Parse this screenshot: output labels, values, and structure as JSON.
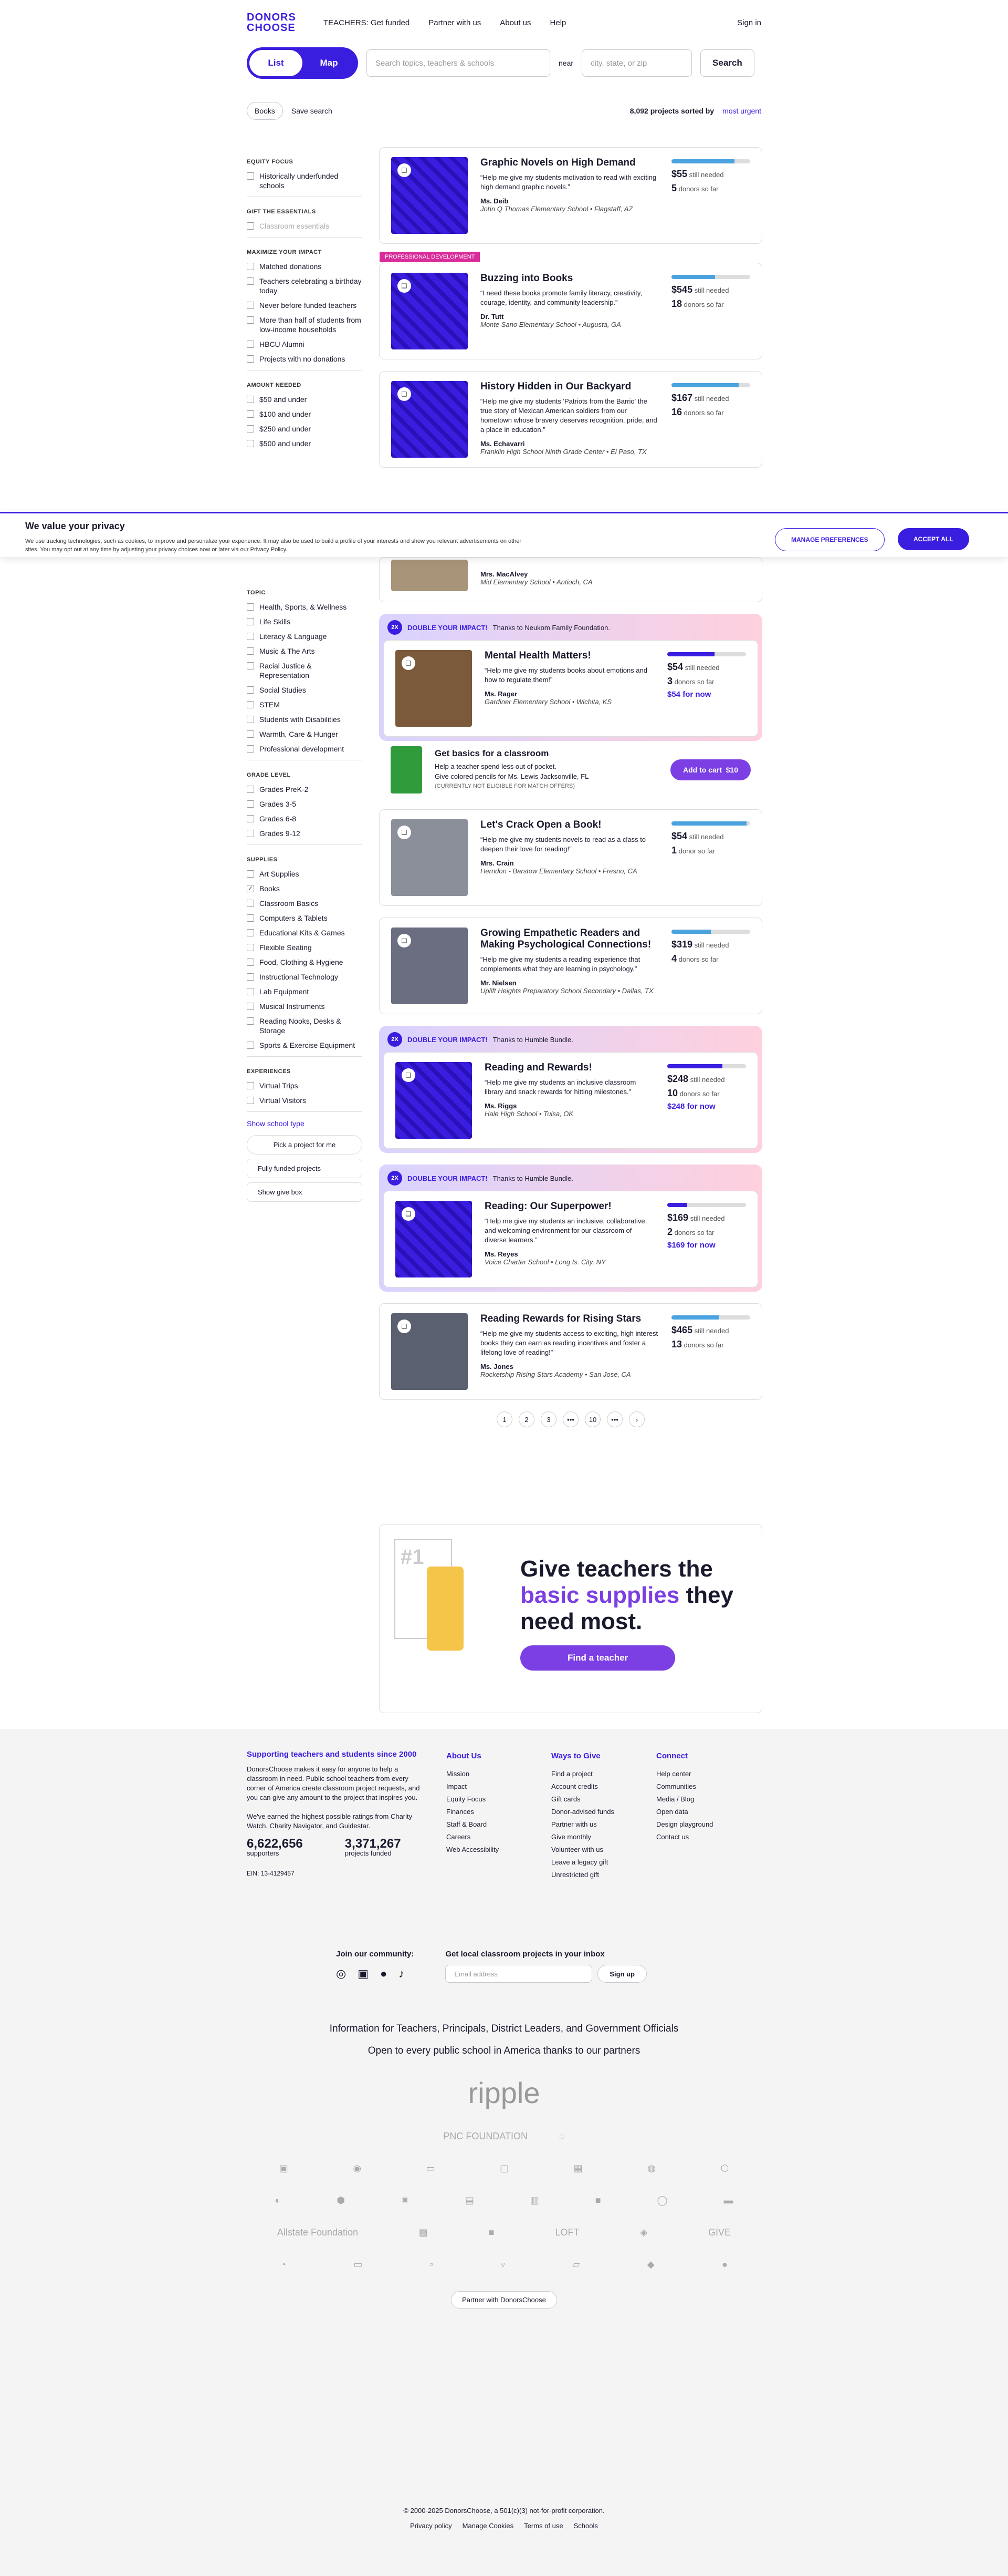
{
  "nav": {
    "logo": "DONORS CHOOSE",
    "teachers": "TEACHERS: Get funded",
    "partner": "Partner with us",
    "about": "About us",
    "help": "Help",
    "signin": "Sign in"
  },
  "search": {
    "list": "List",
    "map": "Map",
    "placeholder": "Search topics, teachers & schools",
    "near": "near",
    "city_placeholder": "city, state, or zip",
    "button": "Search"
  },
  "filters": {
    "books": "Books",
    "save": "Save search",
    "count": "8,092 projects sorted by",
    "sort": "most urgent"
  },
  "sidebar": {
    "equity": "EQUITY FOCUS",
    "hist": "Historically underfunded schools",
    "gift": "GIFT THE ESSENTIALS",
    "classroom": "Classroom essentials",
    "maximize": "MAXIMIZE YOUR IMPACT",
    "matched": "Matched donations",
    "birthday": "Teachers celebrating a birthday today",
    "never": "Never before funded teachers",
    "half": "More than half of students from low-income households",
    "hbcu": "HBCU Alumni",
    "nodon": "Projects with no donations",
    "amount": "AMOUNT NEEDED",
    "a50": "$50 and under",
    "a100": "$100 and under",
    "a250": "$250 and under",
    "a500": "$500 and under",
    "topic": "TOPIC",
    "topics": [
      "Health, Sports, & Wellness",
      "Life Skills",
      "Literacy & Language",
      "Music & The Arts",
      "Racial Justice & Representation",
      "Social Studies",
      "STEM",
      "Students with Disabilities",
      "Warmth, Care & Hunger",
      "Professional development"
    ],
    "grade": "GRADE LEVEL",
    "grades": [
      "Grades PreK-2",
      "Grades 3-5",
      "Grades 6-8",
      "Grades 9-12"
    ],
    "supplies": "SUPPLIES",
    "supplyItems": [
      "Art Supplies",
      "Books",
      "Classroom Basics",
      "Computers & Tablets",
      "Educational Kits & Games",
      "Flexible Seating",
      "Food, Clothing & Hygiene",
      "Instructional Technology",
      "Lab Equipment",
      "Musical Instruments",
      "Reading Nooks, Desks & Storage",
      "Sports & Exercise Equipment"
    ],
    "experiences": "EXPERIENCES",
    "exp": [
      "Virtual Trips",
      "Virtual Visitors"
    ],
    "showschool": "Show school type",
    "pick": "Pick a project for me",
    "fully": "Fully funded projects",
    "give": "Show give box"
  },
  "cards": [
    {
      "title": "Graphic Novels on High Demand",
      "quote": "“Help me give my students motivation to read with exciting high demand graphic novels.”",
      "teacher": "Ms. Deib",
      "school": "John Q Thomas Elementary School • Flagstaff, AZ",
      "amount": "$55",
      "still": "still needed",
      "donors": "5",
      "donlbl": "donors so far",
      "fill": 0.8
    },
    {
      "title": "Buzzing into Books",
      "quote": "“I need these books promote family literacy, creativity, courage, identity, and community leadership.”",
      "teacher": "Dr. Tutt",
      "school": "Monte Sano Elementary School • Augusta, GA",
      "amount": "$545",
      "still": "still needed",
      "donors": "18",
      "donlbl": "donors so far",
      "fill": 0.55,
      "tag": "PROFESSIONAL DEVELOPMENT"
    },
    {
      "title": "History Hidden in Our Backyard",
      "quote": "“Help me give my students 'Patriots from the Barrio' the true story of Mexican American soldiers from our hometown whose bravery deserves recognition, pride, and a place in education.”",
      "teacher": "Ms. Echavarri",
      "school": "Franklin High School Ninth Grade Center • El Paso, TX",
      "amount": "$167",
      "still": "still needed",
      "donors": "16",
      "donlbl": "donors so far",
      "fill": 0.85
    }
  ],
  "partial": {
    "teacher": "Mrs. MacAlvey",
    "school": "Mid Elementary School • Antioch, CA"
  },
  "match1": {
    "x": "2X",
    "title": "DOUBLE YOUR IMPACT!",
    "thanks": "Thanks to Neukom Family Foundation.",
    "card": {
      "title": "Mental Health Matters!",
      "quote": "“Help me give my students books about emotions and how to regulate them!”",
      "teacher": "Ms. Rager",
      "school": "Gardiner Elementary School • Wichita, KS",
      "amount": "$54",
      "still": "still needed",
      "donors": "3",
      "donlbl": "donors so far",
      "now": "$54 for now",
      "fill": 0.6
    }
  },
  "basics": {
    "title": "Get basics for a classroom",
    "l1": "Help a teacher spend less out of pocket.",
    "l2": "Give colored pencils for Ms. Lewis Jacksonville, FL",
    "l3": "(CURRENTLY NOT ELIGIBLE FOR MATCH OFFERS)",
    "btn": "Add to cart",
    "price": "$10"
  },
  "cards2": [
    {
      "title": "Let's Crack Open a Book!",
      "quote": "“Help me give my students novels to read as a class to deepen their love for reading!”",
      "teacher": "Mrs. Crain",
      "school": "Herndon - Barstow Elementary School • Fresno, CA",
      "amount": "$54",
      "still": "still needed",
      "donors": "1",
      "donlbl": "donor so far",
      "fill": 0.95
    },
    {
      "title": "Growing Empathetic Readers and Making Psychological Connections!",
      "quote": "“Help me give my students a reading experience that complements what they are learning in psychology.”",
      "teacher": "Mr. Nielsen",
      "school": "Uplift Heights Preparatory School Secondary • Dallas, TX",
      "amount": "$319",
      "still": "still needed",
      "donors": "4",
      "donlbl": "donors so far",
      "fill": 0.5
    }
  ],
  "match2": {
    "x": "2X",
    "title": "DOUBLE YOUR IMPACT!",
    "thanks": "Thanks to Humble Bundle.",
    "card": {
      "title": "Reading and Rewards!",
      "quote": "“Help me give my students an inclusive classroom library and snack rewards for hitting milestones.”",
      "teacher": "Ms. Riggs",
      "school": "Hale High School • Tulsa, OK",
      "amount": "$248",
      "still": "still needed",
      "donors": "10",
      "donlbl": "donors so far",
      "now": "$248 for now",
      "fill": 0.7
    }
  },
  "match3": {
    "x": "2X",
    "title": "DOUBLE YOUR IMPACT!",
    "thanks": "Thanks to Humble Bundle.",
    "card": {
      "title": "Reading: Our Superpower!",
      "quote": "“Help me give my students an inclusive, collaborative, and welcoming environment for our classroom of diverse learners.”",
      "teacher": "Ms. Reyes",
      "school": "Voice Charter School • Long Is. City, NY",
      "amount": "$169",
      "still": "still needed",
      "donors": "2",
      "donlbl": "donors so far",
      "now": "$169 for now",
      "fill": 0.25
    }
  },
  "card_last": {
    "title": "Reading Rewards for Rising Stars",
    "quote": "“Help me give my students access to exciting, high interest books they can earn as reading incentives and foster a lifelong love of reading!”",
    "teacher": "Ms. Jones",
    "school": "Rocketship Rising Stars Academy • San Jose, CA",
    "amount": "$465",
    "still": "still needed",
    "donors": "13",
    "donlbl": "donors so far",
    "fill": 0.6
  },
  "pager": [
    "1",
    "2",
    "3",
    "•••",
    "10",
    "•••",
    "›"
  ],
  "promo": {
    "a": "Give teachers the",
    "b": "basic supplies",
    "c": "they need most.",
    "btn": "Find a teacher",
    "num": "#1"
  },
  "cookie": {
    "title": "We value your privacy",
    "text": "We use tracking technologies, such as cookies, to improve and personalize your experience. It may also be used to build a profile of your interests and show you relevant advertisements on other sites. You may opt out at any time by adjusting your privacy choices now or later via our Privacy Policy.",
    "manage": "MANAGE PREFERENCES",
    "accept": "ACCEPT ALL"
  },
  "footer": {
    "h": "Supporting teachers and students since 2000",
    "p1": "DonorsChoose makes it easy for anyone to help a classroom in need. Public school teachers from every corner of America create classroom project requests, and you can give any amount to the project that inspires you.",
    "p2": "We've earned the highest possible ratings from Charity Watch, Charity Navigator, and Guidestar.",
    "n1": "6,622,656",
    "l1": "supporters",
    "n2": "3,371,267",
    "l2": "projects funded",
    "ein": "EIN: 13-4129457",
    "about": "About Us",
    "aboutItems": [
      "Mission",
      "Impact",
      "Equity Focus",
      "Finances",
      "Staff & Board",
      "Careers",
      "Web Accessibility"
    ],
    "ways": "Ways to Give",
    "waysItems": [
      "Find a project",
      "Account credits",
      "Gift cards",
      "Donor-advised funds",
      "Partner with us",
      "Give monthly",
      "Volunteer with us",
      "Leave a legacy gift",
      "Unrestricted gift"
    ],
    "connect": "Connect",
    "connectItems": [
      "Help center",
      "Communities",
      "Media / Blog",
      "Open data",
      "Design playground",
      "Contact us"
    ],
    "join": "Join our community:",
    "local": "Get local classroom projects in your inbox",
    "email": "Email address",
    "signup": "Sign up",
    "info": "Information for Teachers, Principals, District Leaders, and Government Officials",
    "open": "Open to every public school in America thanks to our partners",
    "ripple": "ripple",
    "pnc": "PNC FOUNDATION",
    "allstate": "Allstate Foundation",
    "loft": "LOFT",
    "give": "GIVE",
    "partnerBtn": "Partner with DonorsChoose",
    "copy": "© 2000-2025 DonorsChoose, a 501(c)(3) not-for-profit corporation.",
    "privacy": "Privacy policy",
    "cookies": "Manage Cookies",
    "terms": "Terms of use",
    "schools": "Schools"
  }
}
